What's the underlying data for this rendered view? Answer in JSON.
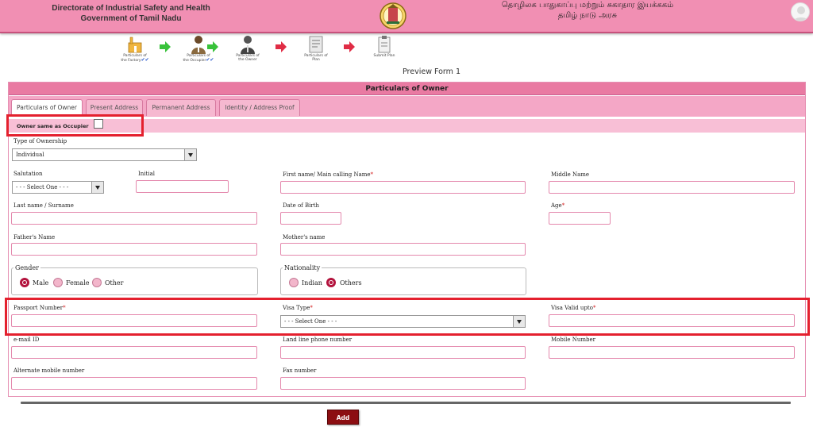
{
  "header": {
    "org_en_line1": "Directorate of Industrial Safety and Health",
    "org_en_line2": "Government of Tamil Nadu",
    "org_ta_line1": "தொழிலக பாதுகாப்பு மற்றும் சுகாதார இயக்ககம்",
    "org_ta_line2": "தமிழ் நாடு அரசு"
  },
  "steps": [
    {
      "label_1": "Particulars of",
      "label_2": "the Factory",
      "done": true
    },
    {
      "label_1": "Particulars of",
      "label_2": "the Occupier",
      "done": true
    },
    {
      "label_1": "Particulars of",
      "label_2": "the Owner",
      "done": false
    },
    {
      "label_1": "Particulars of",
      "label_2": "Plan",
      "done": false
    },
    {
      "label_1": "Submit Plan",
      "label_2": "",
      "done": false
    }
  ],
  "preview_label": "Preview Form 1",
  "panel_title": "Particulars of Owner",
  "tabs": [
    {
      "label": "Particulars of Owner",
      "active": true
    },
    {
      "label": "Present Address",
      "active": false
    },
    {
      "label": "Permanent Address",
      "active": false
    },
    {
      "label": "Identity / Address Proof",
      "active": false
    }
  ],
  "owner_same_label": "Owner same as Occupier",
  "fields": {
    "type_of_ownership": {
      "label": "Type of Ownership",
      "value": "Individual"
    },
    "salutation": {
      "label": "Salutation",
      "value": "- - - Select One - - -"
    },
    "initial": {
      "label": "Initial",
      "value": ""
    },
    "first_name": {
      "label": "First name/ Main calling Name",
      "value": ""
    },
    "middle_name": {
      "label": "Middle Name",
      "value": ""
    },
    "last_name": {
      "label": "Last name / Surname",
      "value": ""
    },
    "dob": {
      "label": "Date of Birth",
      "value": ""
    },
    "age": {
      "label": "Age",
      "value": ""
    },
    "father_name": {
      "label": "Father's Name",
      "value": ""
    },
    "mother_name": {
      "label": "Mother's name",
      "value": ""
    },
    "gender": {
      "legend": "Gender",
      "options": [
        "Male",
        "Female",
        "Other"
      ],
      "selected": "Male"
    },
    "nationality": {
      "legend": "Nationality",
      "options": [
        "Indian",
        "Others"
      ],
      "selected": "Others"
    },
    "passport": {
      "label": "Passport Number",
      "value": ""
    },
    "visa_type": {
      "label": "Visa Type",
      "value": "- - - Select One - - -"
    },
    "visa_valid": {
      "label": "Visa Valid upto",
      "value": ""
    },
    "email": {
      "label": "e-mail ID",
      "value": ""
    },
    "landline": {
      "label": "Land line phone number",
      "value": ""
    },
    "mobile": {
      "label": "Mobile Number",
      "value": ""
    },
    "alt_mobile": {
      "label": "Alternate mobile number",
      "value": ""
    },
    "fax": {
      "label": "Fax number",
      "value": ""
    }
  },
  "required_mark": "*",
  "add_label": "Add",
  "colors": {
    "header_bg": "#f18fb3",
    "panel_title_bg": "#e97aa2",
    "highlight_box": "#e4202e",
    "add_button": "#8c0e12"
  }
}
